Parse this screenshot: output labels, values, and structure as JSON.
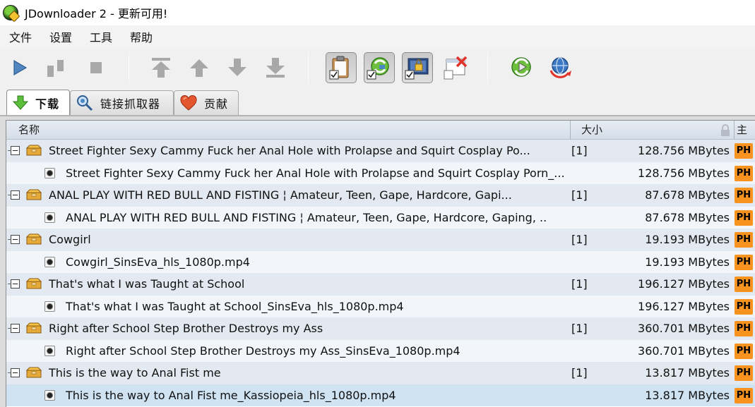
{
  "window": {
    "title": "JDownloader 2 - 更新可用!"
  },
  "menu": [
    "文件",
    "设置",
    "工具",
    "帮助"
  ],
  "toolbar": {
    "buttons": [
      {
        "name": "start-downloads-button",
        "icon": "play-icon"
      },
      {
        "name": "pause-downloads-button",
        "icon": "pause-icon"
      },
      {
        "name": "stop-downloads-button",
        "icon": "stop-icon"
      },
      {
        "name": "move-to-top-button",
        "icon": "arrow-top-icon"
      },
      {
        "name": "move-up-button",
        "icon": "arrow-up-icon"
      },
      {
        "name": "move-down-button",
        "icon": "arrow-down-icon"
      },
      {
        "name": "move-to-bottom-button",
        "icon": "arrow-bottom-icon"
      },
      {
        "name": "clipboard-observer-toggle",
        "icon": "clipboard-icon"
      },
      {
        "name": "auto-reconnect-toggle",
        "icon": "reconnect-icon"
      },
      {
        "name": "premium-toggle",
        "icon": "premium-lock-icon"
      },
      {
        "name": "silent-mode-toggle",
        "icon": "window-close-icon"
      },
      {
        "name": "reconnect-button",
        "icon": "reconnect-play-icon"
      },
      {
        "name": "update-button",
        "icon": "globe-update-icon"
      }
    ]
  },
  "tabs": [
    {
      "label": "下载",
      "icon": "download-arrow-icon",
      "active": true
    },
    {
      "label": "链接抓取器",
      "icon": "linkgrabber-icon",
      "active": false
    },
    {
      "label": "贡献",
      "icon": "heart-icon",
      "active": false
    }
  ],
  "table": {
    "columns": {
      "name": "名称",
      "size": "大小",
      "host": "主"
    },
    "host_badge": "PH",
    "rows": [
      {
        "type": "package",
        "name": "Street Fighter Sexy Cammy Fuck her Anal Hole with Prolapse and Squirt Cosplay Po...",
        "count": "[1]",
        "size": "128.756 MBytes"
      },
      {
        "type": "file",
        "name": "Street Fighter Sexy Cammy Fuck her Anal Hole with Prolapse and Squirt Cosplay Porn_...",
        "size": "128.756 MBytes"
      },
      {
        "type": "package",
        "name": "ANAL PLAY WITH RED BULL AND FISTING ¦ Amateur, Teen, Gape, Hardcore, Gapi...",
        "count": "[1]",
        "size": "87.678 MBytes"
      },
      {
        "type": "file",
        "name": "ANAL PLAY WITH RED BULL AND FISTING ¦ Amateur, Teen, Gape, Hardcore, Gaping, ..",
        "size": "87.678 MBytes"
      },
      {
        "type": "package",
        "name": "Cowgirl",
        "count": "[1]",
        "size": "19.193 MBytes"
      },
      {
        "type": "file",
        "name": "Cowgirl_SinsEva_hls_1080p.mp4",
        "size": "19.193 MBytes"
      },
      {
        "type": "package",
        "name": "That's what I was Taught at School",
        "count": "[1]",
        "size": "196.127 MBytes"
      },
      {
        "type": "file",
        "name": "That's what I was Taught at School_SinsEva_hls_1080p.mp4",
        "size": "196.127 MBytes"
      },
      {
        "type": "package",
        "name": "Right after School Step Brother Destroys my Ass",
        "count": "[1]",
        "size": "360.701 MBytes"
      },
      {
        "type": "file",
        "name": "Right after School Step Brother Destroys my Ass_SinsEva_1080p.mp4",
        "size": "360.701 MBytes"
      },
      {
        "type": "package",
        "name": "This is the way to Anal Fist me",
        "count": "[1]",
        "size": "13.817 MBytes"
      },
      {
        "type": "file",
        "name": "This is the way to Anal Fist me_Kassiopeia_hls_1080p.mp4",
        "size": "13.817 MBytes",
        "selected": true
      }
    ]
  }
}
